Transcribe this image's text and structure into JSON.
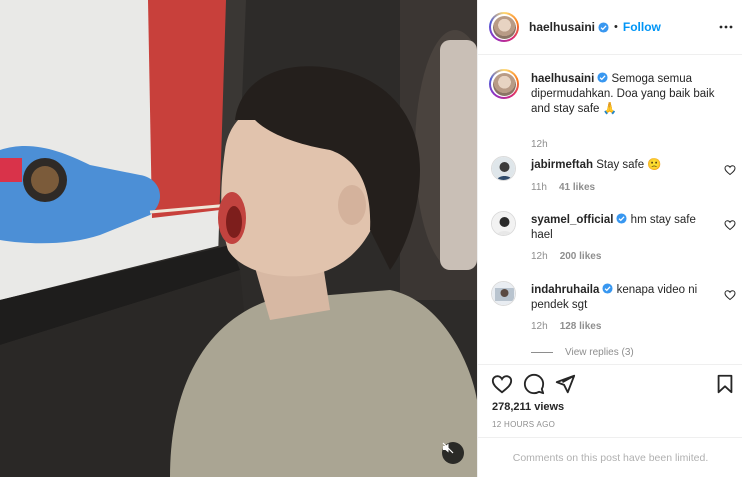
{
  "post": {
    "username": "haelhusaini",
    "follow_label": "Follow",
    "separator": "•",
    "caption_text": "Semoga semua dipermudahkan. Doa yang baik baik and stay safe 🙏",
    "caption_time": "12h",
    "views": "278,211 views",
    "posted_ago": "12 HOURS AGO",
    "comments_limited": "Comments on this post have been limited."
  },
  "comments": [
    {
      "username": "jabirmeftah",
      "verified": false,
      "text": "Stay safe 🙁",
      "time": "11h",
      "likes": "41 likes"
    },
    {
      "username": "syamel_official",
      "verified": true,
      "text": "hm stay safe hael",
      "time": "12h",
      "likes": "200 likes"
    },
    {
      "username": "indahruhaila",
      "verified": true,
      "text": "kenapa video ni pendek sgt",
      "time": "12h",
      "likes": "128 likes"
    }
  ],
  "view_replies": "View replies (3)",
  "icons": {
    "more": "more-options-icon",
    "like": "heart-icon",
    "comment": "comment-bubble-icon",
    "share": "paper-plane-icon",
    "save": "bookmark-icon",
    "mute": "speaker-muted-icon",
    "verified": "verified-badge-icon"
  },
  "colors": {
    "link": "#0095f6",
    "muted": "#8e8e8e",
    "verified": "#3897f0"
  }
}
